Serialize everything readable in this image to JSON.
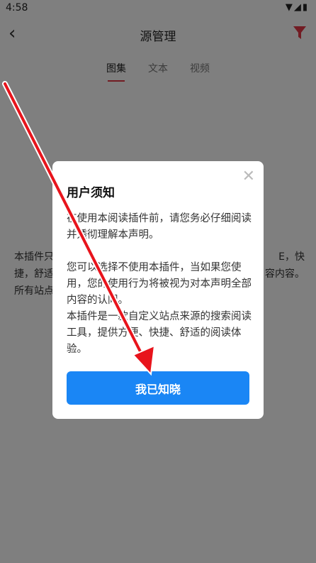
{
  "status_bar": {
    "time": "4:58",
    "icons": [
      "wifi-icon",
      "signal-icon",
      "battery-icon"
    ]
  },
  "app_bar": {
    "title": "源管理",
    "back_icon": "back-arrow-icon",
    "filter_icon": "filter-icon",
    "filter_color": "#e53946"
  },
  "tabs": [
    {
      "label": "图集",
      "active": true
    },
    {
      "label": "文本",
      "active": false
    },
    {
      "label": "视频",
      "active": false
    }
  ],
  "background_text": {
    "line1_start": "本插件只",
    "line1_end": "E，快",
    "line2_start": "捷，舒适",
    "line2_end": "容内容。",
    "line3": "所有站点"
  },
  "dialog": {
    "title": "用户须知",
    "close_icon": "close-icon",
    "paragraphs": [
      "在使用本阅读插件前，请您务必仔细阅读并透彻理解本声明。",
      "您可以选择不使用本插件，当如果您使用，您的使用行为将被视为对本声明全部内容的认同。",
      "本插件是一款自定义站点来源的搜索阅读工具，提供方便、快捷、舒适的阅读体验。"
    ],
    "confirm_label": "我已知晓"
  },
  "colors": {
    "accent_red": "#e53946",
    "button_blue": "#1a86f5"
  }
}
